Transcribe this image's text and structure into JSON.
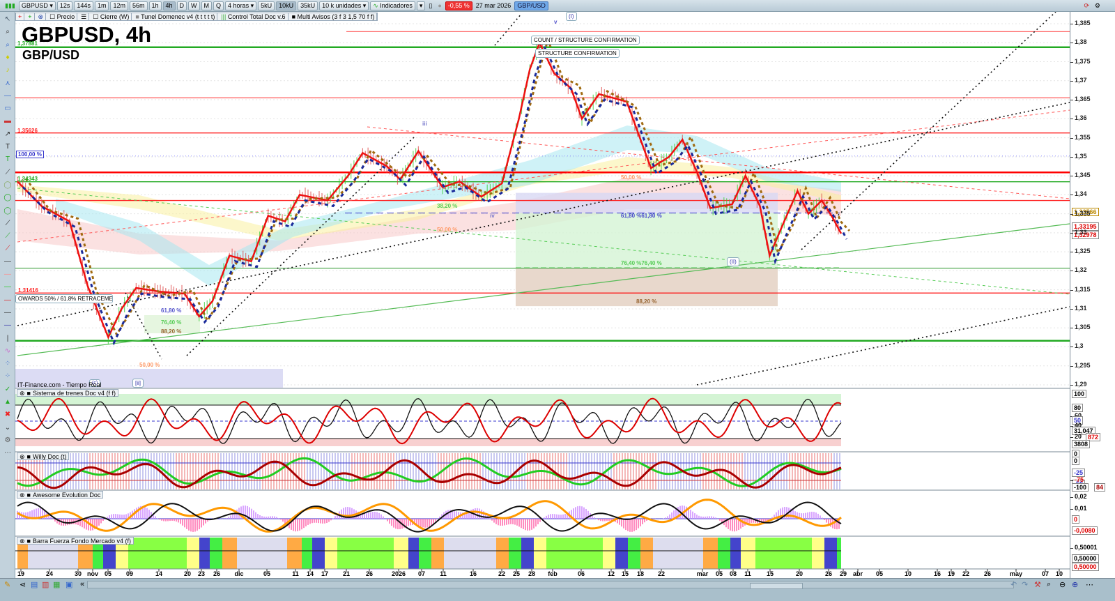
{
  "toolbar": {
    "symbol": "GBPUSD",
    "timeframes": [
      "12s",
      "144s",
      "1m",
      "12m",
      "56m",
      "1h",
      "4h",
      "D",
      "W",
      "M",
      "Q"
    ],
    "selected_timeframe": "4h",
    "period": "4 horas",
    "volumes": [
      "5kU",
      "10kU",
      "35kU"
    ],
    "selected_volume": "10kU",
    "units": "10 k unidades",
    "indicators": "Indicadores",
    "change": "-0,55 %",
    "date": "27 mar 2026",
    "pair_badge": "GBP/USD"
  },
  "legend": {
    "items": [
      "Precio",
      "Cierre (W)",
      "Tunel Domenec v4 (t t t t t)",
      "Control Total Doc v.6",
      "Multi Avisos (3 f 3 1,5 70 f f)"
    ]
  },
  "header": {
    "title": "GBPUSD, 4h",
    "subtitle": "GBP/USD"
  },
  "levels": {
    "l1": "1,37881",
    "l2": "1,35626",
    "l3": "100,00 %",
    "l4": "1,34343",
    "l5": "1,31416"
  },
  "annotations": {
    "count": "COUNT / STRUCTURE CONFIRMATION",
    "structure": "STRUCTURE CONFIRMATION",
    "wave_i": "(I)",
    "wave_v": "v",
    "wave_ii": "(II)",
    "wave_iii": "iii",
    "wave_iv": "iv",
    "wave_c": "(c)",
    "wave_ii_small": "[ii]",
    "retracement": "OWARDS 50% / 61.8% RETRACEMENT",
    "source": "IT-Finance.com - Tiempo Real"
  },
  "fibs": {
    "f382": "38,20 %",
    "f50a": "50,00 %",
    "f50b": "50,00 %",
    "f50c": "50,00 %",
    "f618a": "61,80 %",
    "f618b": "61,80 %61,80 %",
    "f764a": "76,40 %",
    "f764b": "76,40 %76,40 %",
    "f882a": "88,20 %",
    "f882b": "88,20 %"
  },
  "price_axis": {
    "ticks": [
      "1,385",
      "1,38",
      "1,375",
      "1,37",
      "1,365",
      "1,36",
      "1,355",
      "1,35",
      "1,345",
      "1,34",
      "1,335",
      "1,33",
      "1,325",
      "1,32",
      "1,315",
      "1,31",
      "1,305",
      "1,3",
      "1,295",
      "1,29"
    ],
    "boxes": {
      "b1": "1,33566",
      "b2": "1,33195",
      "b3": "1,32978"
    }
  },
  "panels": [
    {
      "title": "Sistema de trenes Doc v4 (f f)",
      "axis": [
        "100",
        "80",
        "60",
        "50",
        "40",
        "31,047",
        "20",
        "872",
        "3808"
      ]
    },
    {
      "title": "Willy Doc (t)",
      "axis": [
        "0",
        "0",
        "-25",
        "-50",
        "-75",
        "-100",
        "84"
      ]
    },
    {
      "title": "Awesome Evolution Doc",
      "axis": [
        "0,02",
        "0,01",
        "0",
        "-0,0080"
      ]
    },
    {
      "title": "Barra Fuerza Fondo Mercado v4 (f)",
      "axis": [
        "0,50001",
        "0,50000",
        "0,50000"
      ]
    }
  ],
  "date_axis": [
    "19",
    "24",
    "30",
    "nov",
    "05",
    "09",
    "14",
    "20",
    "23",
    "26",
    "dic",
    "05",
    "11",
    "14",
    "17",
    "21",
    "26",
    "2026",
    "07",
    "11",
    "16",
    "22",
    "25",
    "28",
    "feb",
    "06",
    "12",
    "15",
    "18",
    "22",
    "mar",
    "05",
    "08",
    "11",
    "15",
    "20",
    "26",
    "29",
    "abr",
    "05",
    "10",
    "16",
    "19",
    "22",
    "26",
    "may",
    "07",
    "10"
  ],
  "colors": {
    "up": "#00cc00",
    "down": "#ee0000",
    "accent_red": "#ff0000",
    "accent_green": "#22aa22",
    "blue": "#1a2a9a"
  },
  "chart_data": {
    "type": "line",
    "title": "GBPUSD, 4h",
    "ylim": [
      1.29,
      1.385
    ],
    "x_unit": "4h bar index",
    "close": [
      [
        0,
        1.3435
      ],
      [
        20,
        1.337
      ],
      [
        43,
        1.333
      ],
      [
        58,
        1.316
      ],
      [
        75,
        1.3025
      ],
      [
        86,
        1.31
      ],
      [
        98,
        1.3155
      ],
      [
        118,
        1.3145
      ],
      [
        138,
        1.314
      ],
      [
        150,
        1.308
      ],
      [
        161,
        1.312
      ],
      [
        175,
        1.324
      ],
      [
        193,
        1.3225
      ],
      [
        207,
        1.3345
      ],
      [
        221,
        1.333
      ],
      [
        233,
        1.34
      ],
      [
        256,
        1.3385
      ],
      [
        273,
        1.345
      ],
      [
        285,
        1.351
      ],
      [
        305,
        1.3475
      ],
      [
        316,
        1.344
      ],
      [
        331,
        1.3515
      ],
      [
        351,
        1.342
      ],
      [
        365,
        1.3435
      ],
      [
        383,
        1.3395
      ],
      [
        400,
        1.343
      ],
      [
        414,
        1.36
      ],
      [
        423,
        1.373
      ],
      [
        431,
        1.38
      ],
      [
        443,
        1.372
      ],
      [
        457,
        1.368
      ],
      [
        466,
        1.36
      ],
      [
        480,
        1.3665
      ],
      [
        503,
        1.3645
      ],
      [
        523,
        1.347
      ],
      [
        538,
        1.35
      ],
      [
        549,
        1.3545
      ],
      [
        561,
        1.346
      ],
      [
        572,
        1.3365
      ],
      [
        590,
        1.3375
      ],
      [
        601,
        1.345
      ],
      [
        613,
        1.337
      ],
      [
        621,
        1.324
      ],
      [
        633,
        1.333
      ],
      [
        644,
        1.341
      ],
      [
        653,
        1.335
      ],
      [
        664,
        1.3385
      ],
      [
        673,
        1.334
      ],
      [
        680,
        1.3298
      ]
    ],
    "horizontal_levels": [
      {
        "price": 1.38291,
        "color": "#ff6666"
      },
      {
        "price": 1.37881,
        "color": "#22aa22"
      },
      {
        "price": 1.3655,
        "color": "#ff6666"
      },
      {
        "price": 1.35626,
        "color": "#ff2222"
      },
      {
        "price": 1.3459,
        "color": "#ff0000"
      },
      {
        "price": 1.34343,
        "color": "#22aa22"
      },
      {
        "price": 1.3385,
        "color": "#ff2222"
      },
      {
        "price": 1.3207,
        "color": "#55aa55"
      },
      {
        "price": 1.31416,
        "color": "#ff0000"
      },
      {
        "price": 1.3016,
        "color": "#22aa22"
      }
    ]
  }
}
